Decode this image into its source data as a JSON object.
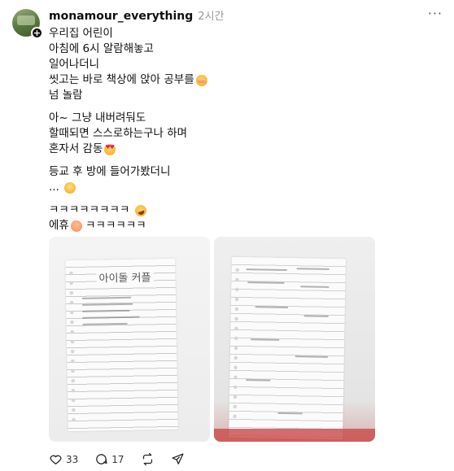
{
  "post": {
    "username": "monamour_everything",
    "timestamp": "2시간",
    "paragraphs": [
      {
        "lines": [
          {
            "text": "우리집 어린이",
            "emoji": ""
          },
          {
            "text": "아침에 6시 알람해놓고",
            "emoji": ""
          },
          {
            "text": "일어나더니",
            "emoji": ""
          },
          {
            "text": "씻고는 바로 책상에 앉아 공부를",
            "emoji": "blush-face"
          },
          {
            "text": "넘 놀람",
            "emoji": ""
          }
        ]
      },
      {
        "lines": [
          {
            "text": "아~ 그냥 내버려둬도",
            "emoji": ""
          },
          {
            "text": "할때되면 스스로하는구나 하며",
            "emoji": ""
          },
          {
            "text": "혼자서 감동",
            "emoji": "heart-eyes-face"
          }
        ]
      },
      {
        "lines": [
          {
            "text": "등교 후 방에 들어가봤더니",
            "emoji": ""
          },
          {
            "text": "...",
            "emoji": "relieved-face"
          }
        ]
      },
      {
        "lines": [
          {
            "text": "ㅋㅋㅋㅋㅋㅋㅋㅋ",
            "emoji": "rolling-laughing-face"
          },
          {
            "text": "에휴",
            "emoji": "cold-sweat-face",
            "suffix": "ㅋㅋㅋㅋㅋㅋ"
          }
        ]
      }
    ],
    "images": {
      "left_title": "아이돌 커플"
    },
    "actions": {
      "likes": "33",
      "replies": "17"
    }
  }
}
